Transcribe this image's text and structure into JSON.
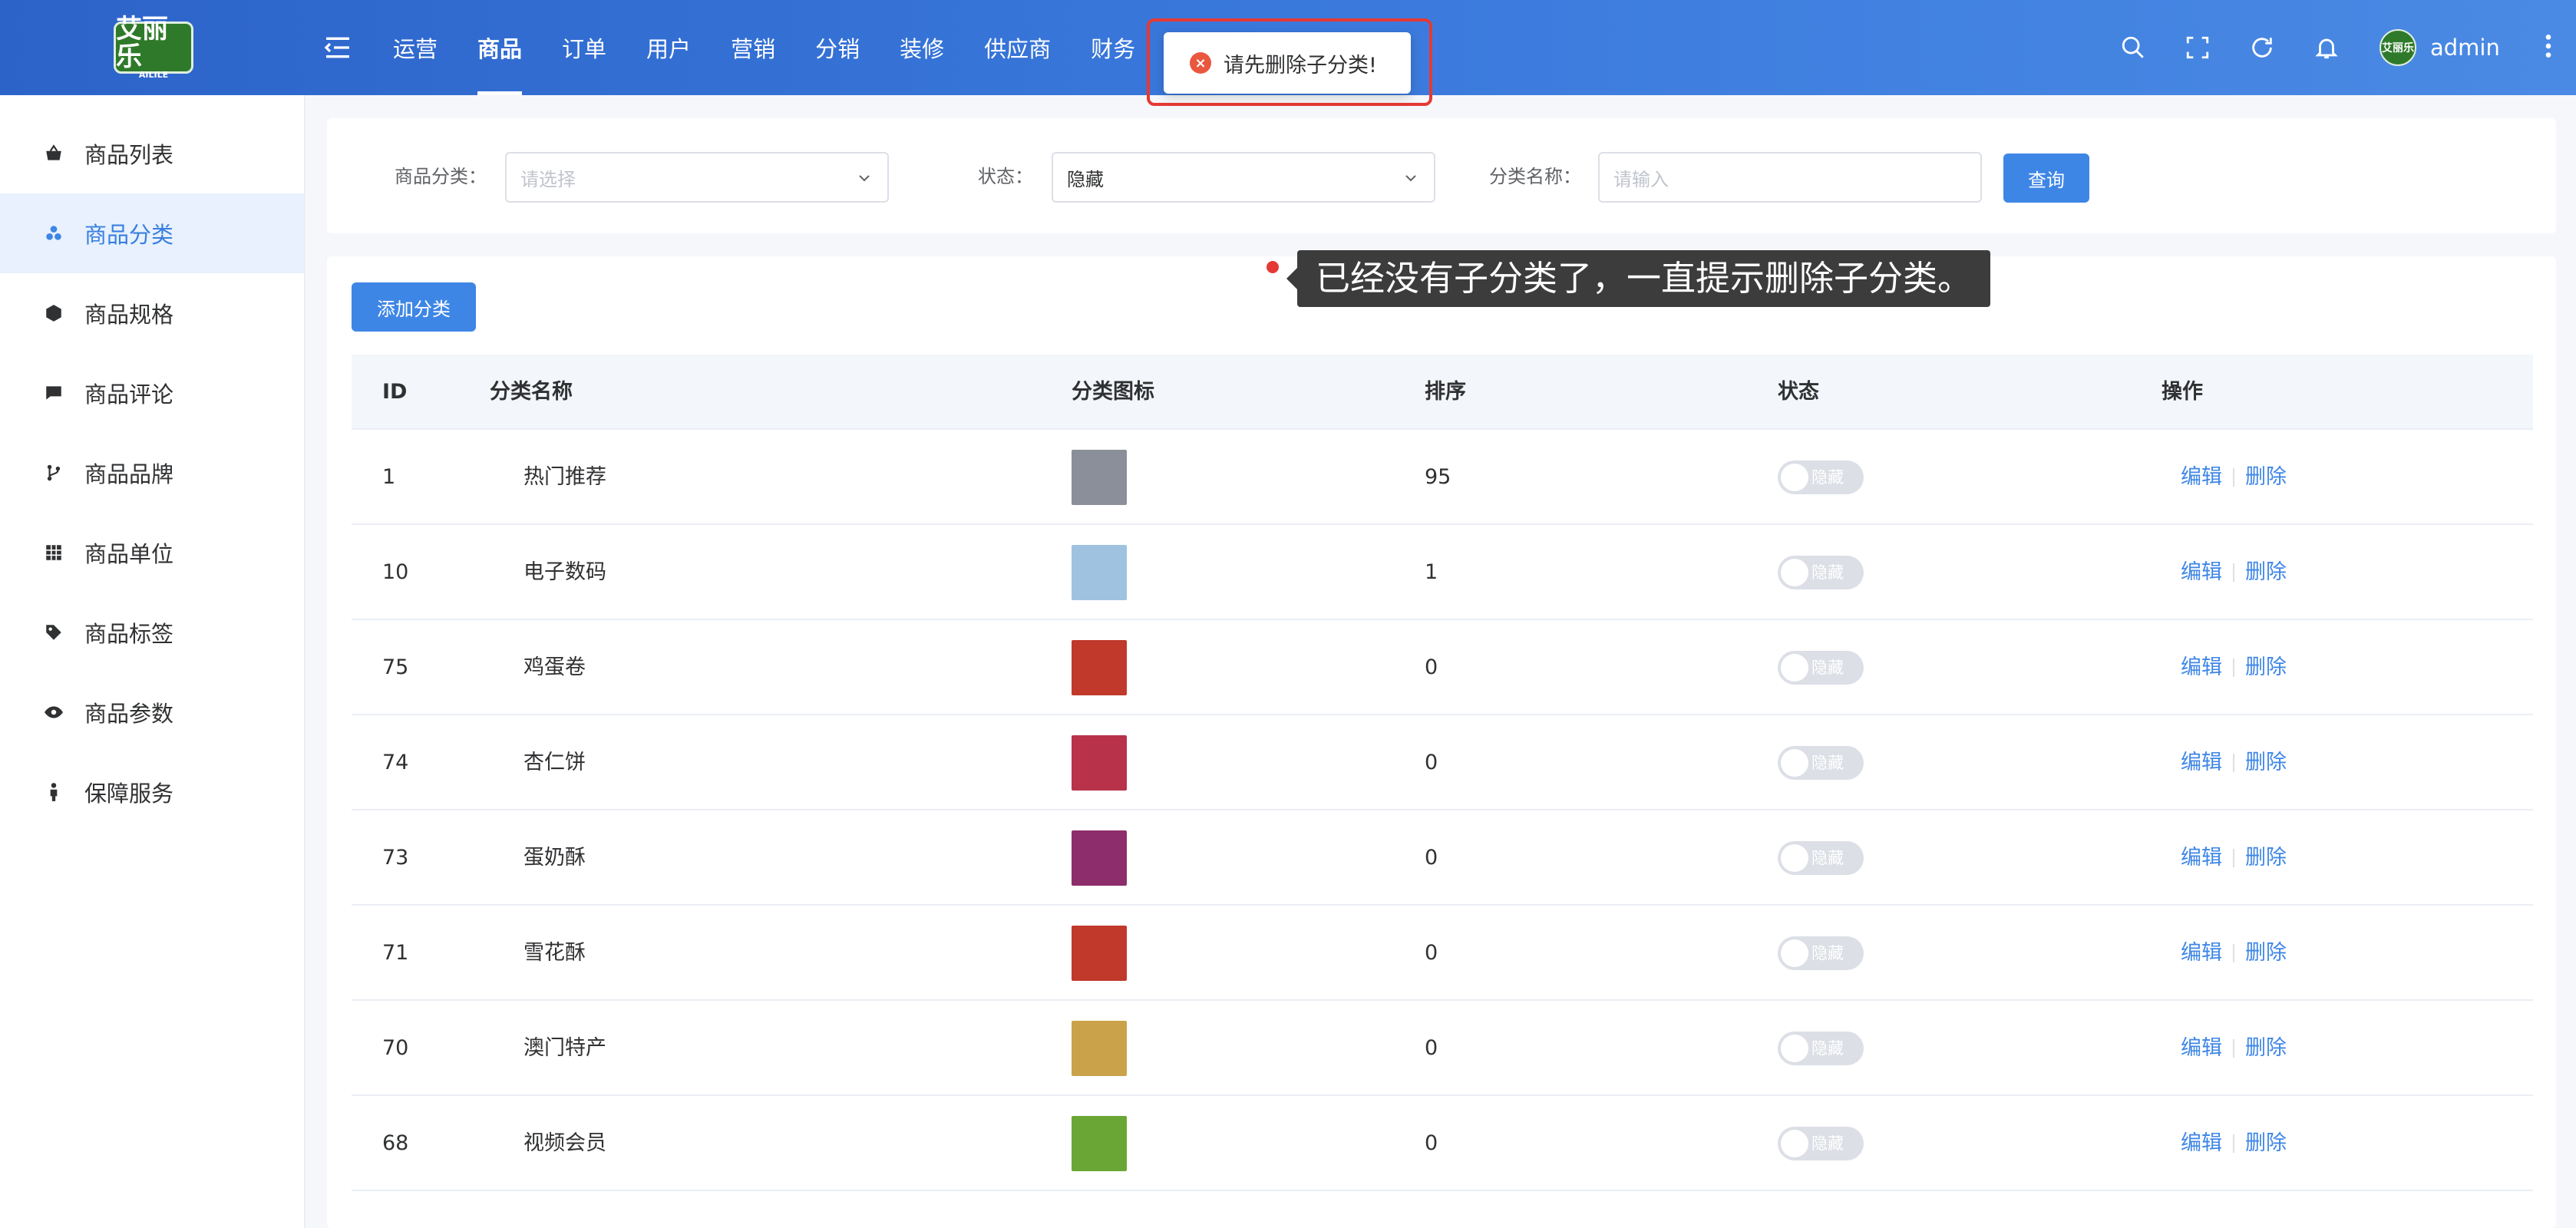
{
  "brand": {
    "name": "艾丽乐",
    "sub": "AILILE"
  },
  "nav": [
    {
      "label": "运营",
      "active": false
    },
    {
      "label": "商品",
      "active": true
    },
    {
      "label": "订单",
      "active": false
    },
    {
      "label": "用户",
      "active": false
    },
    {
      "label": "营销",
      "active": false
    },
    {
      "label": "分销",
      "active": false
    },
    {
      "label": "装修",
      "active": false
    },
    {
      "label": "供应商",
      "active": false
    },
    {
      "label": "财务",
      "active": false
    }
  ],
  "user": {
    "name": "admin",
    "avatar_text": "艾丽乐"
  },
  "header_icons": [
    "search-icon",
    "fullscreen-icon",
    "refresh-icon",
    "bell-icon"
  ],
  "sidebar": {
    "items": [
      {
        "label": "商品列表",
        "icon": "basket-icon",
        "active": false
      },
      {
        "label": "商品分类",
        "icon": "category-icon",
        "active": true
      },
      {
        "label": "商品规格",
        "icon": "cube-icon",
        "active": false
      },
      {
        "label": "商品评论",
        "icon": "comment-icon",
        "active": false
      },
      {
        "label": "商品品牌",
        "icon": "brand-icon",
        "active": false
      },
      {
        "label": "商品单位",
        "icon": "grid-icon",
        "active": false
      },
      {
        "label": "商品标签",
        "icon": "tag-icon",
        "active": false
      },
      {
        "label": "商品参数",
        "icon": "eye-icon",
        "active": false
      },
      {
        "label": "保障服务",
        "icon": "person-icon",
        "active": false
      }
    ]
  },
  "filters": {
    "category_label": "商品分类：",
    "category_placeholder": "请选择",
    "status_label": "状态：",
    "status_value": "隐藏",
    "name_label": "分类名称：",
    "name_placeholder": "请输入",
    "query_button": "查询"
  },
  "table": {
    "add_button": "添加分类",
    "columns": {
      "id": "ID",
      "name": "分类名称",
      "icon": "分类图标",
      "sort": "排序",
      "status": "状态",
      "ops": "操作"
    },
    "rows": [
      {
        "id": "1",
        "name": "热门推荐",
        "sort": "95",
        "status": "隐藏",
        "thumb": "#8a8f99"
      },
      {
        "id": "10",
        "name": "电子数码",
        "sort": "1",
        "status": "隐藏",
        "thumb": "#9fc2e0"
      },
      {
        "id": "75",
        "name": "鸡蛋卷",
        "sort": "0",
        "status": "隐藏",
        "thumb": "#c0392b"
      },
      {
        "id": "74",
        "name": "杏仁饼",
        "sort": "0",
        "status": "隐藏",
        "thumb": "#b8324a"
      },
      {
        "id": "73",
        "name": "蛋奶酥",
        "sort": "0",
        "status": "隐藏",
        "thumb": "#8e2d6b"
      },
      {
        "id": "71",
        "name": "雪花酥",
        "sort": "0",
        "status": "隐藏",
        "thumb": "#c0392b"
      },
      {
        "id": "70",
        "name": "澳门特产",
        "sort": "0",
        "status": "隐藏",
        "thumb": "#c9a24a"
      },
      {
        "id": "68",
        "name": "视频会员",
        "sort": "0",
        "status": "隐藏",
        "thumb": "#6aa636"
      }
    ],
    "edit_label": "编辑",
    "delete_label": "删除"
  },
  "toast": {
    "message": "请先删除子分类!"
  },
  "annotation": {
    "text": "已经没有子分类了，一直提示删除子分类。"
  },
  "colors": {
    "primary": "#3e86e6",
    "header_start": "#2c63c9",
    "header_end": "#4a8ae4",
    "error": "#e53935"
  }
}
